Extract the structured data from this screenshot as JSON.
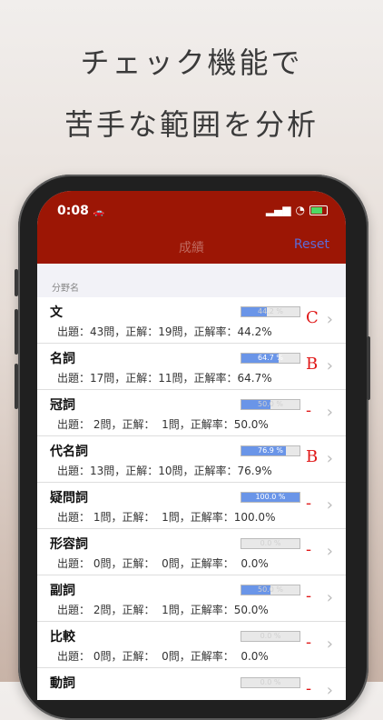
{
  "headline": {
    "line1": "チェック機能で",
    "line2": "苦手な範囲を分析"
  },
  "status": {
    "time": "0:08",
    "car": "🚗",
    "signal": "▂▄▆",
    "wifi": "◔"
  },
  "nav": {
    "title": "成績",
    "reset": "Reset"
  },
  "section_label": "分野名",
  "colors": {
    "nav_bg": "#9c1605",
    "bar_fill": "#6a95e8",
    "grade": "#e01818",
    "reset": "#5b6bd8"
  },
  "rows": [
    {
      "name": "文",
      "stats": "出題：43問，正解：19問，正解率：44.2%",
      "pct": 44.2,
      "bar_text": "44.2 %",
      "grade": "C"
    },
    {
      "name": "名詞",
      "stats": "出題：17問，正解：11問，正解率：64.7%",
      "pct": 64.7,
      "bar_text": "64.7 %",
      "grade": "B"
    },
    {
      "name": "冠詞",
      "stats": "出題： 2問，正解：  1問，正解率：50.0%",
      "pct": 50.0,
      "bar_text": "50.0 %",
      "grade": "-"
    },
    {
      "name": "代名詞",
      "stats": "出題：13問，正解：10問，正解率：76.9%",
      "pct": 76.9,
      "bar_text": "76.9 %",
      "grade": "B"
    },
    {
      "name": "疑問詞",
      "stats": "出題： 1問，正解：  1問，正解率：100.0%",
      "pct": 100.0,
      "bar_text": "100.0 %",
      "grade": "-"
    },
    {
      "name": "形容詞",
      "stats": "出題： 0問，正解：  0問，正解率：  0.0%",
      "pct": 0.0,
      "bar_text": "0.0 %",
      "grade": "-"
    },
    {
      "name": "副詞",
      "stats": "出題： 2問，正解：  1問，正解率：50.0%",
      "pct": 50.0,
      "bar_text": "50.0 %",
      "grade": "-"
    },
    {
      "name": "比較",
      "stats": "出題： 0問，正解：  0問，正解率：  0.0%",
      "pct": 0.0,
      "bar_text": "0.0 %",
      "grade": "-"
    },
    {
      "name": "動詞",
      "stats": "",
      "pct": 0.0,
      "bar_text": "0.0 %",
      "grade": "-"
    }
  ]
}
